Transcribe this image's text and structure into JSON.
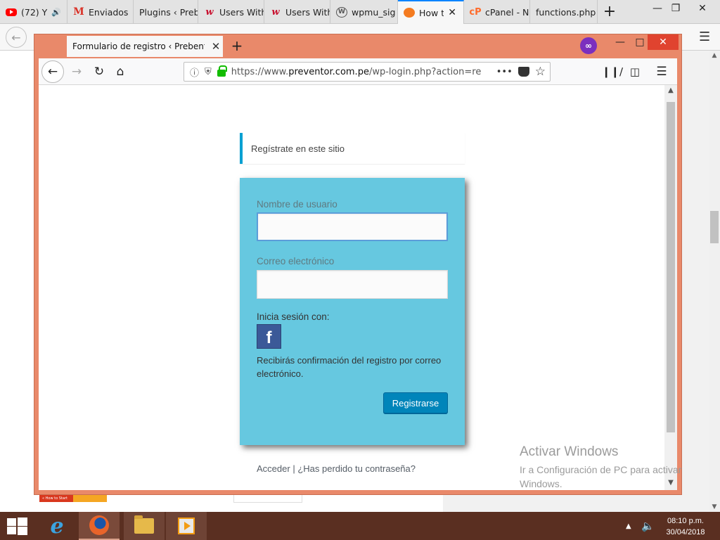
{
  "background_browser": {
    "tabs": [
      {
        "label": "(72) Y",
        "icon": "youtube-icon",
        "audio": true
      },
      {
        "label": "Enviados",
        "icon": "gmail-icon"
      },
      {
        "label": "Plugins ‹ Preb",
        "icon": null
      },
      {
        "label": "Users With",
        "icon": "wp-users-icon"
      },
      {
        "label": "Users With",
        "icon": "wp-users-icon"
      },
      {
        "label": "wpmu_sig",
        "icon": "wordpress-icon"
      },
      {
        "label": "How t",
        "icon": "howto-icon",
        "active": true
      },
      {
        "label": "cPanel - N",
        "icon": "cpanel-icon"
      },
      {
        "label": "functions.php",
        "icon": null
      }
    ],
    "new_tab": "+",
    "strip_label": "« How to Start"
  },
  "window": {
    "tab_title": "Formulario de registro ‹ Prebentor",
    "new_tab": "+",
    "url_prefix": "https://www.",
    "url_domain": "preventor.com.pe",
    "url_path": "/wp-login.php?action=re",
    "menu_dots": "•••"
  },
  "page": {
    "message": "Regístrate en este sitio",
    "username_label": "Nombre de usuario",
    "username_value": "",
    "email_label": "Correo electrónico",
    "email_value": "",
    "social_label": "Inicia sesión con:",
    "facebook_glyph": "f",
    "note": "Recibirás confirmación del registro por correo electrónico.",
    "register_button": "Registrarse",
    "login_link": "Acceder",
    "separator": "|",
    "lost_password_link": "¿Has perdido tu contraseña?"
  },
  "watermark": {
    "title": "Activar Windows",
    "subtitle": "Ir a Configuración de PC para activar Windows."
  },
  "taskbar": {
    "time": "08:10 p.m.",
    "date": "30/04/2018"
  },
  "colors": {
    "window_frame": "#e9896a",
    "form_bg": "#66c8e0",
    "button": "#0085ba",
    "taskbar": "#5a2f21",
    "notice_border": "#00a0d2"
  }
}
